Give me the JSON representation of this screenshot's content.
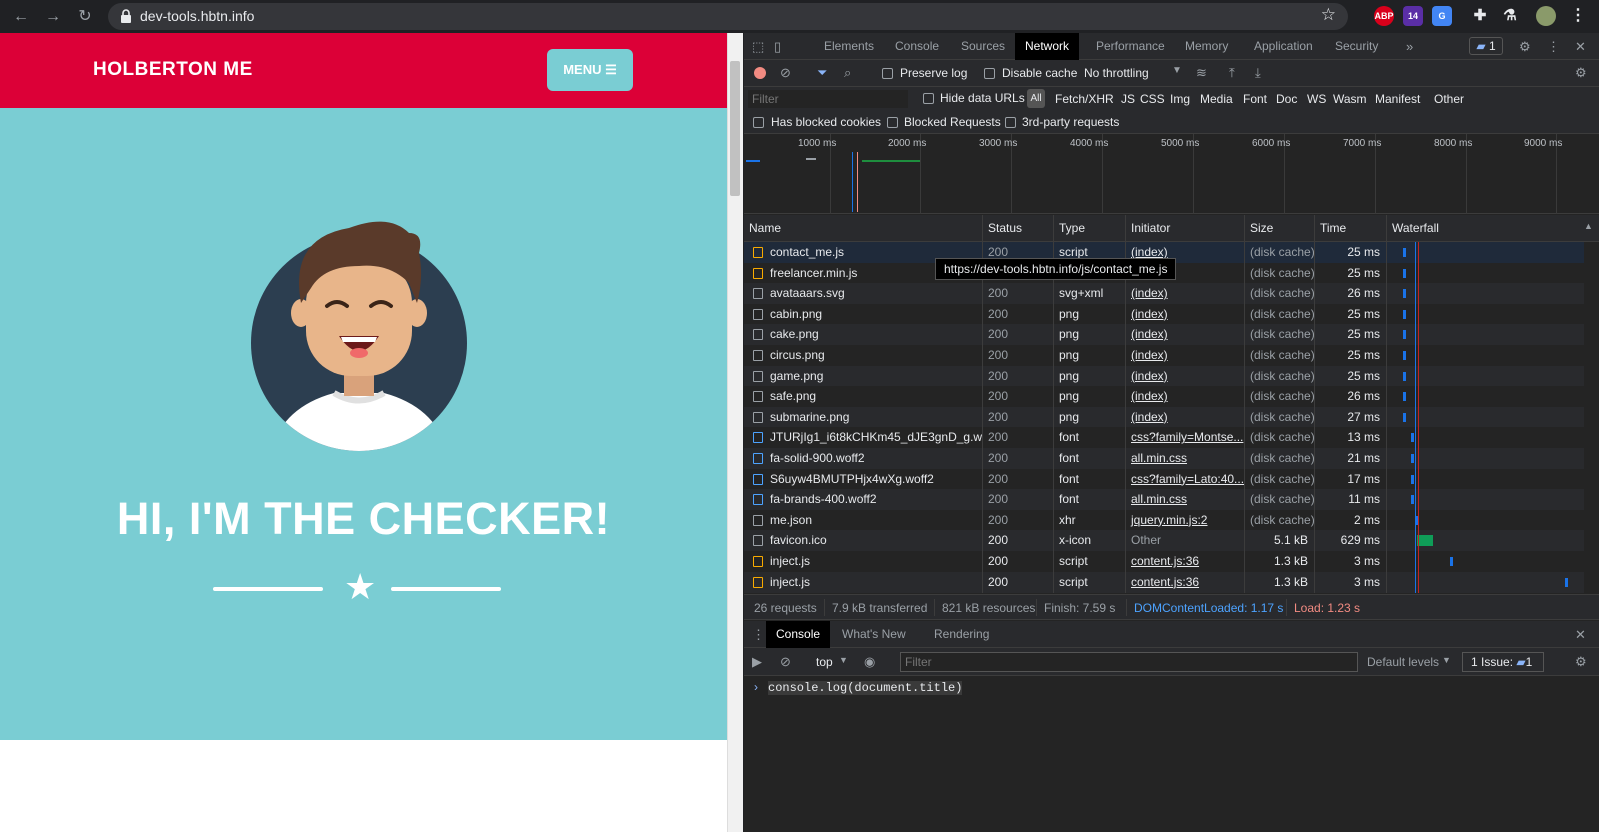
{
  "browser": {
    "url": "dev-tools.hbtn.info",
    "extension_badge": "ABP",
    "extension_count": "14"
  },
  "site": {
    "brand": "HOLBERTON ME",
    "menu_label": "MENU ☰",
    "hero_title": "HI, I'M THE CHECKER!",
    "colors": {
      "header": "#dc0037",
      "hero": "#7acdd3"
    }
  },
  "devtools": {
    "tabs": [
      "Elements",
      "Console",
      "Sources",
      "Network",
      "Performance",
      "Memory",
      "Application",
      "Security"
    ],
    "active_tab": "Network",
    "issues_badge": "1",
    "toolbar": {
      "preserve_log": "Preserve log",
      "disable_cache": "Disable cache",
      "throttling": "No throttling"
    },
    "filter": {
      "placeholder": "Filter",
      "hide_data_urls": "Hide data URLs",
      "all": "All",
      "types": [
        "Fetch/XHR",
        "JS",
        "CSS",
        "Img",
        "Media",
        "Font",
        "Doc",
        "WS",
        "Wasm",
        "Manifest",
        "Other"
      ],
      "has_blocked_cookies": "Has blocked cookies",
      "blocked_requests": "Blocked Requests",
      "third_party": "3rd-party requests"
    },
    "overview_ticks": [
      "1000 ms",
      "2000 ms",
      "3000 ms",
      "4000 ms",
      "5000 ms",
      "6000 ms",
      "7000 ms",
      "8000 ms",
      "9000 ms"
    ],
    "columns": [
      "Name",
      "Status",
      "Type",
      "Initiator",
      "Size",
      "Time",
      "Waterfall"
    ],
    "rows": [
      {
        "name": "contact_me.js",
        "status": "200",
        "type": "script",
        "initiator": "(index)",
        "size": "(disk cache)",
        "time": "25 ms",
        "icon": "js",
        "wf": 0.08
      },
      {
        "name": "freelancer.min.js",
        "status": "200",
        "type": "script",
        "initiator": "(index)",
        "size": "(disk cache)",
        "time": "25 ms",
        "icon": "js",
        "wf": 0.08
      },
      {
        "name": "avataaars.svg",
        "status": "200",
        "type": "svg+xml",
        "initiator": "(index)",
        "size": "(disk cache)",
        "time": "26 ms",
        "icon": "img",
        "wf": 0.08
      },
      {
        "name": "cabin.png",
        "status": "200",
        "type": "png",
        "initiator": "(index)",
        "size": "(disk cache)",
        "time": "25 ms",
        "icon": "img",
        "wf": 0.08
      },
      {
        "name": "cake.png",
        "status": "200",
        "type": "png",
        "initiator": "(index)",
        "size": "(disk cache)",
        "time": "25 ms",
        "icon": "img",
        "wf": 0.08
      },
      {
        "name": "circus.png",
        "status": "200",
        "type": "png",
        "initiator": "(index)",
        "size": "(disk cache)",
        "time": "25 ms",
        "icon": "img",
        "wf": 0.08
      },
      {
        "name": "game.png",
        "status": "200",
        "type": "png",
        "initiator": "(index)",
        "size": "(disk cache)",
        "time": "25 ms",
        "icon": "img",
        "wf": 0.08
      },
      {
        "name": "safe.png",
        "status": "200",
        "type": "png",
        "initiator": "(index)",
        "size": "(disk cache)",
        "time": "26 ms",
        "icon": "img",
        "wf": 0.08
      },
      {
        "name": "submarine.png",
        "status": "200",
        "type": "png",
        "initiator": "(index)",
        "size": "(disk cache)",
        "time": "27 ms",
        "icon": "img",
        "wf": 0.08
      },
      {
        "name": "JTURjIg1_i6t8kCHKm45_dJE3gnD_g.wo...",
        "status": "200",
        "type": "font",
        "initiator": "css?family=Montse...",
        "size": "(disk cache)",
        "time": "13 ms",
        "icon": "font",
        "wf": 0.12
      },
      {
        "name": "fa-solid-900.woff2",
        "status": "200",
        "type": "font",
        "initiator": "all.min.css",
        "size": "(disk cache)",
        "time": "21 ms",
        "icon": "font",
        "wf": 0.12
      },
      {
        "name": "S6uyw4BMUTPHjx4wXg.woff2",
        "status": "200",
        "type": "font",
        "initiator": "css?family=Lato:40...",
        "size": "(disk cache)",
        "time": "17 ms",
        "icon": "font",
        "wf": 0.12
      },
      {
        "name": "fa-brands-400.woff2",
        "status": "200",
        "type": "font",
        "initiator": "all.min.css",
        "size": "(disk cache)",
        "time": "11 ms",
        "icon": "font",
        "wf": 0.12
      },
      {
        "name": "me.json",
        "status": "200",
        "type": "xhr",
        "initiator": "jquery.min.js:2",
        "size": "(disk cache)",
        "time": "2 ms",
        "icon": "doc",
        "wf": 0.14
      },
      {
        "name": "favicon.ico",
        "status": "200",
        "type": "x-icon",
        "initiator": "Other",
        "size": "5.1 kB",
        "time": "629 ms",
        "icon": "doc",
        "wf": 0.15
      },
      {
        "name": "inject.js",
        "status": "200",
        "type": "script",
        "initiator": "content.js:36",
        "size": "1.3 kB",
        "time": "3 ms",
        "icon": "js",
        "wf": 0.32
      },
      {
        "name": "inject.js",
        "status": "200",
        "type": "script",
        "initiator": "content.js:36",
        "size": "1.3 kB",
        "time": "3 ms",
        "icon": "js",
        "wf": 0.9
      }
    ],
    "tooltip": "https://dev-tools.hbtn.info/js/contact_me.js",
    "summary": {
      "requests": "26 requests",
      "transferred": "7.9 kB transferred",
      "resources": "821 kB resources",
      "finish": "Finish: 7.59 s",
      "dcl": "DOMContentLoaded: 1.17 s",
      "load": "Load: 1.23 s"
    },
    "drawer": {
      "tabs": [
        "Console",
        "What's New",
        "Rendering"
      ],
      "context": "top",
      "filter_placeholder": "Filter",
      "levels": "Default levels",
      "issues": "1 Issue:",
      "issues_count": "1",
      "command": "console.log(document.title)"
    }
  }
}
